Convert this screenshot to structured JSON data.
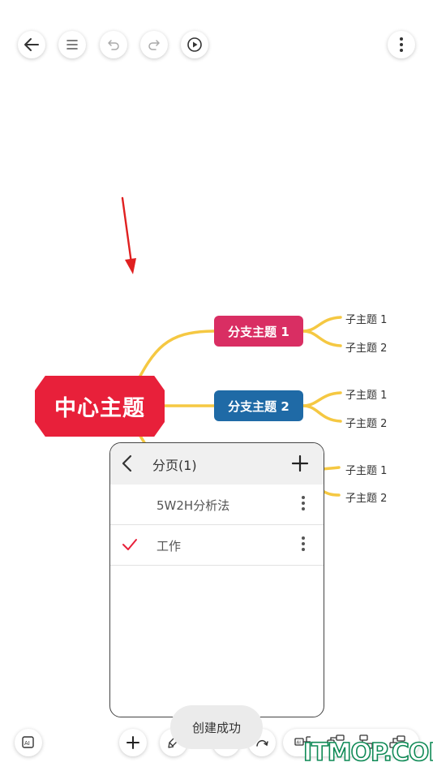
{
  "toolbar": {
    "buttons": [
      {
        "name": "back-button",
        "icon": "arrow-left-icon"
      },
      {
        "name": "outline-button",
        "icon": "list-icon"
      },
      {
        "name": "undo-button",
        "icon": "undo-icon"
      },
      {
        "name": "redo-button",
        "icon": "redo-icon"
      },
      {
        "name": "play-button",
        "icon": "play-icon"
      },
      {
        "name": "more-button",
        "icon": "more-vertical-icon"
      }
    ]
  },
  "mindmap": {
    "central_topic": "中心主题",
    "central_color": "#e8203a",
    "connector_color": "#f5c842",
    "branches": [
      {
        "label": "分支主题 1",
        "color": "#d92e63",
        "subtopics": [
          "子主题 1",
          "子主题 2"
        ]
      },
      {
        "label": "分支主题 2",
        "color": "#1f6aa6",
        "subtopics": [
          "子主题 1",
          "子主题 2"
        ]
      },
      {
        "label": "",
        "color": "#f5c842",
        "subtopics": [
          "子主题 1",
          "子主题 2"
        ]
      }
    ]
  },
  "annotation_arrow_color": "#e02020",
  "page_panel": {
    "title": "分页(1)",
    "items": [
      {
        "label": "5W2H分析法",
        "selected": false
      },
      {
        "label": "工作",
        "selected": true
      }
    ],
    "accent_color": "#e8203a"
  },
  "toast": {
    "message": "创建成功"
  },
  "bottom_bar": {
    "tools": [
      "ai-icon",
      "add-icon",
      "format-brush-icon",
      "pen-icon",
      "relationship-icon",
      "ai-layout-icon",
      "subtopic-icon",
      "sibling-topic-icon",
      "parent-topic-icon"
    ]
  },
  "watermark": {
    "text": "ITMOP.COM",
    "color": "#0f8a56"
  }
}
